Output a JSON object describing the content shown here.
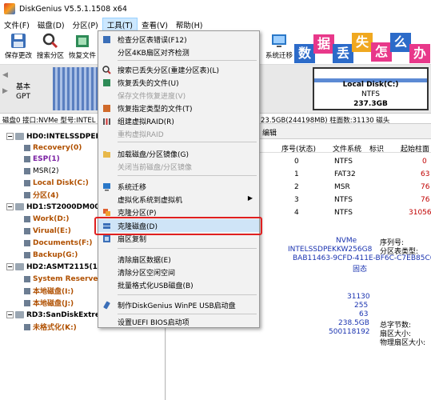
{
  "window": {
    "title": "DiskGenius V5.5.1.1508 x64"
  },
  "menubar": [
    "文件(F)",
    "磁盘(D)",
    "分区(P)",
    "工具(T)",
    "查看(V)",
    "帮助(H)"
  ],
  "toolbar": [
    {
      "label": "保存更改",
      "icon": "save-icon"
    },
    {
      "label": "搜索分区",
      "icon": "search-icon"
    },
    {
      "label": "恢复文件",
      "icon": "recover-icon"
    }
  ],
  "toolbar_right": {
    "label": "系统迁移",
    "icon": "migrate-icon"
  },
  "banner_chars": [
    "数",
    "据",
    "丢",
    "失",
    "怎",
    "么",
    "办"
  ],
  "diskbar": {
    "basic_label_1": "基本",
    "basic_label_2": "GPT",
    "local_c": {
      "name": "Local Disk(C:)",
      "fs": "NTFS",
      "size": "237.3GB"
    }
  },
  "info_line": {
    "left": "磁盘0 接口:NVMe  型号:INTEL",
    "right": "23.5GB(244198MB)  柱面数:31130  磁头"
  },
  "tree": [
    {
      "label": "HD0:INTELSSDPEKK",
      "type": "disk"
    },
    {
      "label": "Recovery(0)",
      "type": "part"
    },
    {
      "label": "ESP(1)",
      "type": "part-purple"
    },
    {
      "label": "MSR(2)",
      "type": "plain"
    },
    {
      "label": "Local Disk(C:)",
      "type": "part"
    },
    {
      "label": "分区(4)",
      "type": "part"
    },
    {
      "label": "HD1:ST2000DM008",
      "type": "disk"
    },
    {
      "label": "Work(D:)",
      "type": "part"
    },
    {
      "label": "Virual(E:)",
      "type": "part"
    },
    {
      "label": "Documents(F:)",
      "type": "part"
    },
    {
      "label": "Backup(G:)",
      "type": "part"
    },
    {
      "label": "HD2:ASMT2115(119",
      "type": "disk"
    },
    {
      "label": "System Reserved",
      "type": "part"
    },
    {
      "label": "本地磁盘(I:)",
      "type": "part"
    },
    {
      "label": "本地磁盘(J:)",
      "type": "part"
    },
    {
      "label": "RD3:SanDiskExtrem",
      "type": "disk"
    },
    {
      "label": "未格式化(K:)",
      "type": "part"
    }
  ],
  "right_tab": "编辑",
  "table": {
    "headers": [
      "序号(状态)",
      "文件系统",
      "标识",
      "起始柱面"
    ],
    "rows": [
      [
        "0",
        "NTFS",
        "",
        "0"
      ],
      [
        "1",
        "FAT32",
        "",
        "63"
      ],
      [
        "2",
        "MSR",
        "",
        "76"
      ],
      [
        "3",
        "NTFS",
        "",
        "76"
      ],
      [
        "4",
        "NTFS",
        "",
        "31056"
      ]
    ]
  },
  "details": {
    "nvme": "NVMe",
    "model": "INTELSSDPEKKW256G8",
    "guid": "BAB11463-9CFD-411E-BF6C-C7EB85C63",
    "guid2": "固态",
    "serial_label": "序列号:",
    "type_label": "分区表类型:",
    "cylinders": "31130",
    "heads": "255",
    "sectors": "63",
    "capacity": "238.5GB",
    "total_sectors": "500118192",
    "total_bytes_label": "总字节数:",
    "sector_size_label": "扇区大小:",
    "physical_sector_label": "物理扇区大小:"
  },
  "dropdown": {
    "items": [
      {
        "label": "检查分区表错误(F12)",
        "icon": "check-icon",
        "disabled": false
      },
      {
        "label": "分区4KB扇区对齐检测",
        "icon": "",
        "disabled": false
      },
      {
        "sep": true
      },
      {
        "label": "搜索已丢失分区(重建分区表)(L)",
        "icon": "search-icon",
        "disabled": false
      },
      {
        "label": "恢复丢失的文件(U)",
        "icon": "recover-icon",
        "disabled": false
      },
      {
        "label": "保存文件恢复进度(V)",
        "icon": "",
        "disabled": true
      },
      {
        "label": "恢复指定类型的文件(T)",
        "icon": "filetype-icon",
        "disabled": false
      },
      {
        "label": "组建虚拟RAID(R)",
        "icon": "raid-icon",
        "disabled": false
      },
      {
        "label": "重构虚拟RAID",
        "icon": "",
        "disabled": true
      },
      {
        "sep": true
      },
      {
        "label": "加载磁盘/分区镜像(G)",
        "icon": "folder-icon",
        "disabled": false
      },
      {
        "label": "关闭当前磁盘/分区镜像",
        "icon": "",
        "disabled": true
      },
      {
        "sep": true
      },
      {
        "label": "系统迁移",
        "icon": "migrate-icon",
        "disabled": false
      },
      {
        "label": "虚拟化系统到虚拟机",
        "icon": "",
        "disabled": false,
        "submenu": true
      },
      {
        "label": "克隆分区(P)",
        "icon": "clone-partition-icon",
        "disabled": false
      },
      {
        "label": "克隆磁盘(D)",
        "icon": "clone-disk-icon",
        "disabled": false,
        "highlighted": true
      },
      {
        "label": "扇区复制",
        "icon": "sector-copy-icon",
        "disabled": false
      },
      {
        "sep": true
      },
      {
        "label": "清除扇区数据(E)",
        "icon": "",
        "disabled": false
      },
      {
        "label": "清除分区空闲空间",
        "icon": "",
        "disabled": false
      },
      {
        "label": "批量格式化USB磁盘(B)",
        "icon": "",
        "disabled": false
      },
      {
        "sep": true
      },
      {
        "label": "制作DiskGenius WinPE USB启动盘",
        "icon": "usb-icon",
        "disabled": false
      },
      {
        "sep": true
      },
      {
        "label": "设置UEFI BIOS启动项",
        "icon": "",
        "disabled": false
      }
    ]
  }
}
